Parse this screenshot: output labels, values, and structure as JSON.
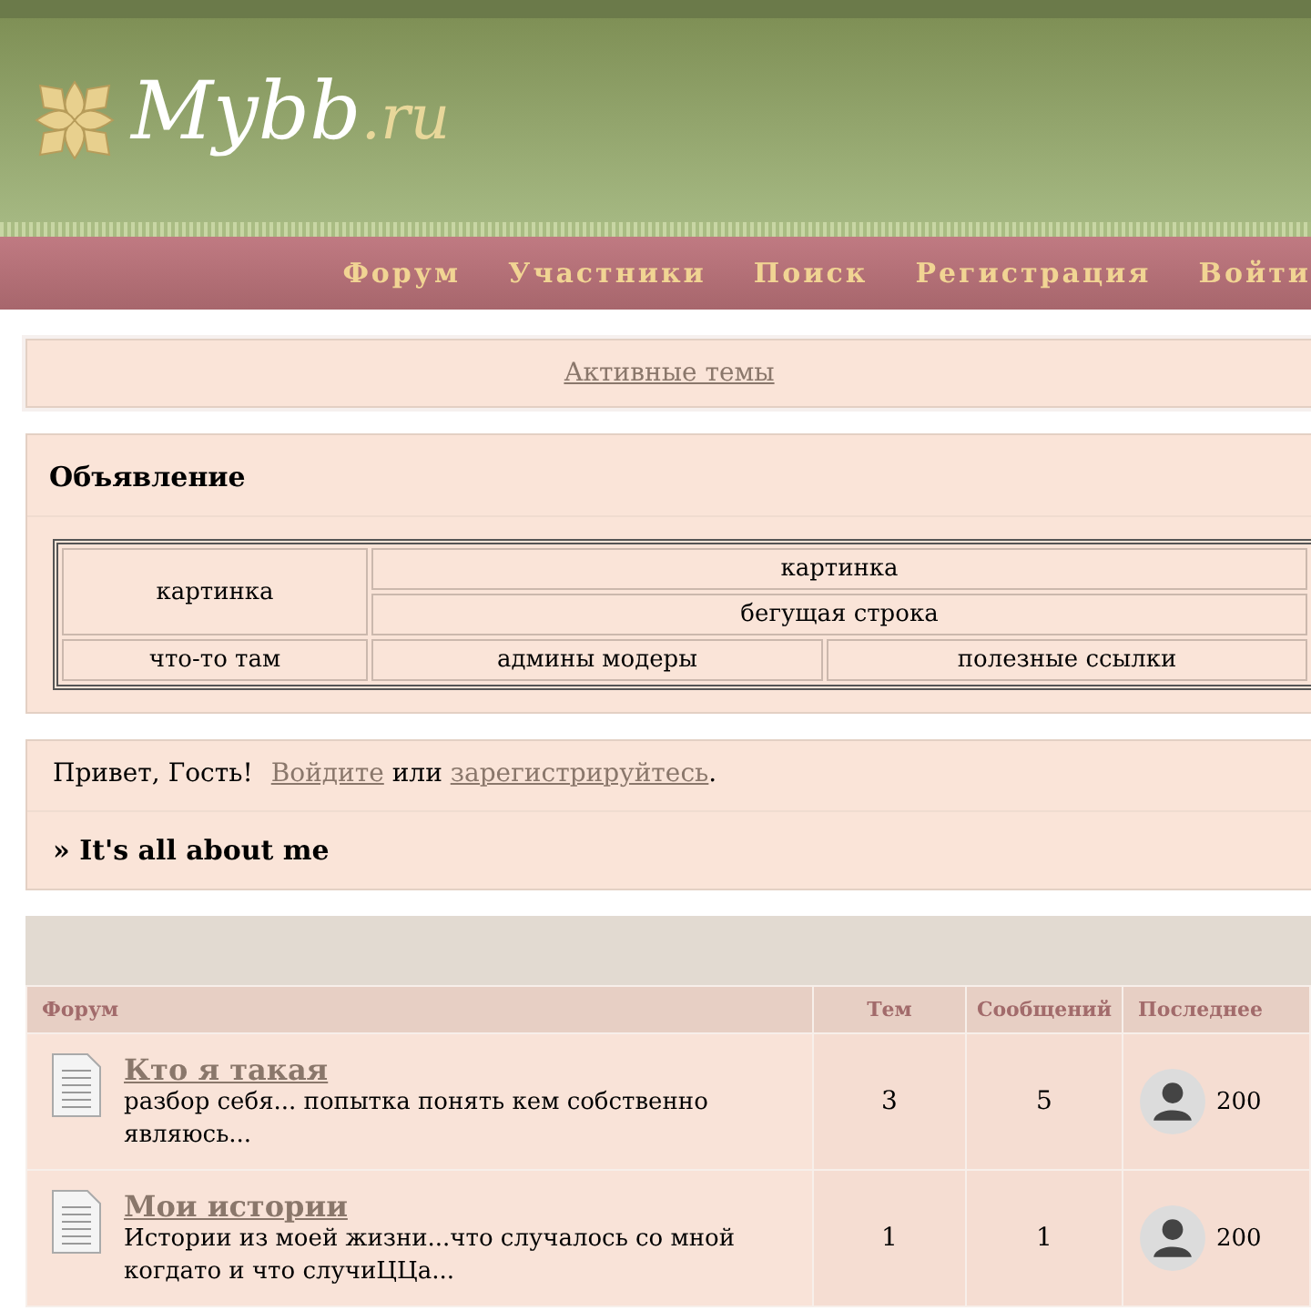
{
  "header": {
    "logo_main": "Mybb",
    "logo_suffix": ".ru"
  },
  "nav": [
    "Форум",
    "Участники",
    "Поиск",
    "Регистрация",
    "Войти"
  ],
  "active_topics": "Активные темы",
  "announcement": {
    "title": "Объявление",
    "top_left": "картинка",
    "top_right": "картинка",
    "marquee": "бегущая строка",
    "bottom": [
      "что-то там",
      "админы модеры",
      "полезные ссылки"
    ]
  },
  "welcome": {
    "greeting": "Привет, Гость!",
    "login_link": "Войдите",
    "connector": "или",
    "register_link": "зарегистрируйтесь",
    "end": "."
  },
  "category": "» It's all about me",
  "forum_table": {
    "columns": [
      "Форум",
      "Тем",
      "Сообщений",
      "Последнее"
    ],
    "rows": [
      {
        "title": "Кто я такая",
        "description": "разбор себя... попытка понять кем собственно являюсь...",
        "topics": "3",
        "posts": "5",
        "last_post": "200"
      },
      {
        "title": "Мои истории",
        "description": "Истории из моей жизни...что случалось со мной когдато и что случиЦЦа...",
        "topics": "1",
        "posts": "1",
        "last_post": "200"
      }
    ]
  }
}
